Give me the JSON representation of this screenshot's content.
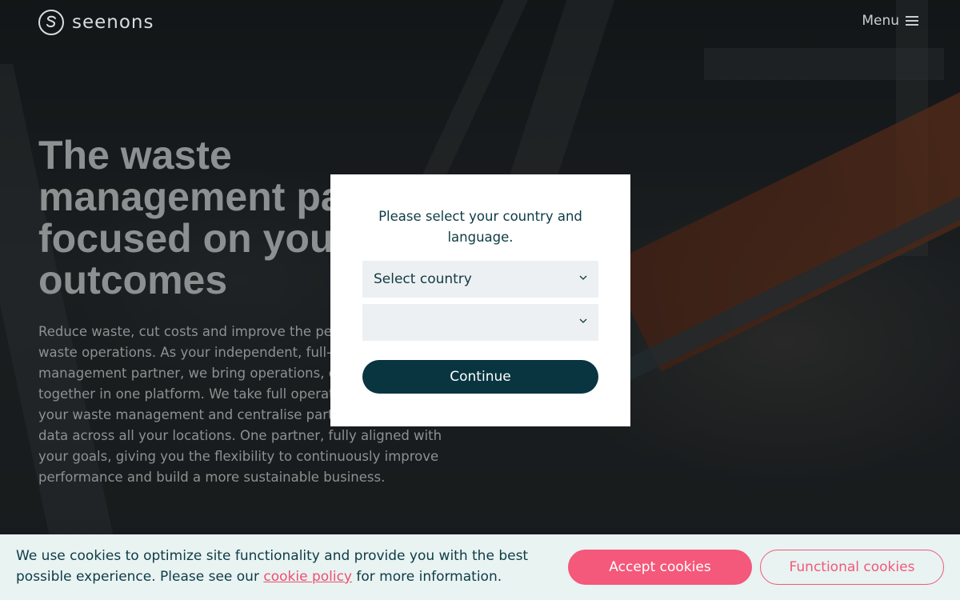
{
  "header": {
    "brand": "seenons",
    "menu_label": "Menu"
  },
  "hero": {
    "title": "The waste management partner focused on your outcomes",
    "body": "Reduce waste, cut costs and improve the performance of your waste operations. As your independent, full-service waste management partner, we bring operations, data and insights together in one platform. We take full operational ownership of your waste management and centralise partners, services and data across all your locations. One partner, fully aligned with your goals, giving you the flexibility to continuously improve performance and build a more sustainable business."
  },
  "modal": {
    "prompt": "Please select your country and language.",
    "country_select": "Select country",
    "language_select": "",
    "continue_label": "Continue"
  },
  "cookie_banner": {
    "text_before": "We use cookies to optimize site functionality and provide you with the best possible experience. Please see our ",
    "link_label": "cookie policy",
    "text_after": " for more information.",
    "accept_label": "Accept cookies",
    "functional_label": "Functional cookies"
  },
  "colors": {
    "brand_dark": "#083540",
    "accent_pink": "#f4587a",
    "cookie_bg": "#e8f3f2"
  }
}
